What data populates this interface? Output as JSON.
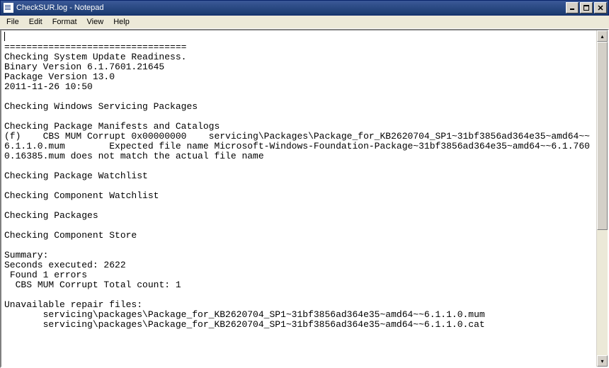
{
  "window": {
    "title": "CheckSUR.log - Notepad"
  },
  "menu": {
    "file": "File",
    "edit": "Edit",
    "format": "Format",
    "view": "View",
    "help": "Help"
  },
  "content": {
    "lines": [
      "=================================",
      "Checking System Update Readiness.",
      "Binary Version 6.1.7601.21645",
      "Package Version 13.0",
      "2011-11-26 10:50",
      "",
      "Checking Windows Servicing Packages",
      "",
      "Checking Package Manifests and Catalogs",
      "(f)    CBS MUM Corrupt 0x00000000    servicing\\Packages\\Package_for_KB2620704_SP1~31bf3856ad364e35~amd64~~6.1.1.0.mum        Expected file name Microsoft-Windows-Foundation-Package~31bf3856ad364e35~amd64~~6.1.7600.16385.mum does not match the actual file name",
      "",
      "Checking Package Watchlist",
      "",
      "Checking Component Watchlist",
      "",
      "Checking Packages",
      "",
      "Checking Component Store",
      "",
      "Summary:",
      "Seconds executed: 2622",
      " Found 1 errors",
      "  CBS MUM Corrupt Total count: 1",
      "",
      "Unavailable repair files:",
      "       servicing\\packages\\Package_for_KB2620704_SP1~31bf3856ad364e35~amd64~~6.1.1.0.mum",
      "       servicing\\packages\\Package_for_KB2620704_SP1~31bf3856ad364e35~amd64~~6.1.1.0.cat",
      ""
    ]
  }
}
